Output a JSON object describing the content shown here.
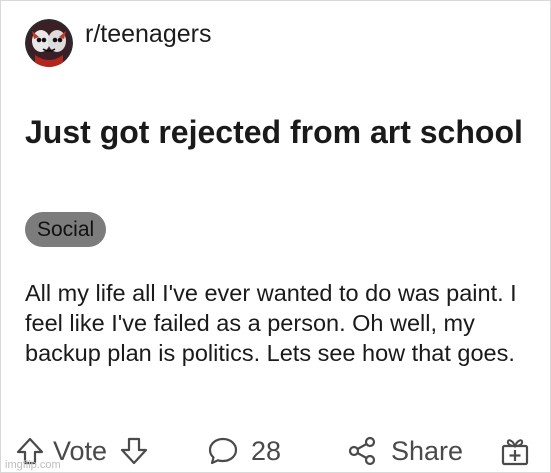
{
  "post": {
    "subreddit": "r/teenagers",
    "title": "Just got rejected from art school",
    "flair": "Social",
    "body": "All my life all I've ever wanted to do was paint. I feel like I've failed as a person. Oh well, my backup plan is politics. Lets see how that goes."
  },
  "actions": {
    "vote_label": "Vote",
    "comment_count": "28",
    "share_label": "Share"
  },
  "icons": {
    "upvote": "arrow-up-outline",
    "downvote": "arrow-down-outline",
    "comments": "speech-bubble",
    "share": "share-nodes",
    "award": "gift-plus"
  },
  "watermark": "imgflip.com",
  "colors": {
    "flair_bg": "#7c7c7c",
    "text": "#1a1a1b",
    "icon": "#4a4a4a"
  }
}
